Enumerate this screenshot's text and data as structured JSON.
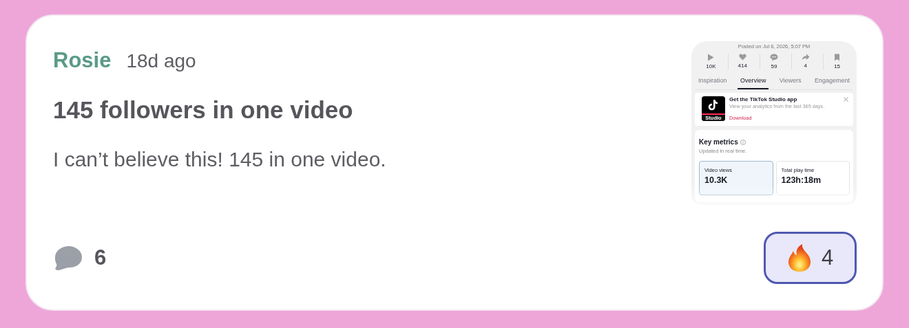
{
  "post": {
    "author": "Rosie",
    "time": "18d ago",
    "title": "145 followers in one video",
    "body": "I can’t believe this! 145 in one video.",
    "comment_count": "6",
    "reaction": {
      "count": "4",
      "selected": true
    }
  },
  "attachment": {
    "posted": "Posted on Jul 6, 2026, 5:07 PM",
    "stats": [
      {
        "kind": "play",
        "value": "10K"
      },
      {
        "kind": "like",
        "value": "414"
      },
      {
        "kind": "comment",
        "value": "59"
      },
      {
        "kind": "share",
        "value": "4"
      },
      {
        "kind": "save",
        "value": "15"
      }
    ],
    "tabs": [
      {
        "label": "Inspiration",
        "selected": false
      },
      {
        "label": "Overview",
        "selected": true
      },
      {
        "label": "Viewers",
        "selected": false
      },
      {
        "label": "Engagement",
        "selected": false
      }
    ],
    "promo": {
      "logo_caption": "Studio",
      "title": "Get the TikTok Studio app",
      "subtitle": "View your analytics from the last 365 days.",
      "link": "Download"
    },
    "metrics": {
      "title": "Key metrics",
      "subtitle": "Updated in real time.",
      "tiles": [
        {
          "label": "Video views",
          "value": "10.3K",
          "selected": true
        },
        {
          "label": "Total play time",
          "value": "123h:18m",
          "selected": false
        }
      ]
    }
  }
}
